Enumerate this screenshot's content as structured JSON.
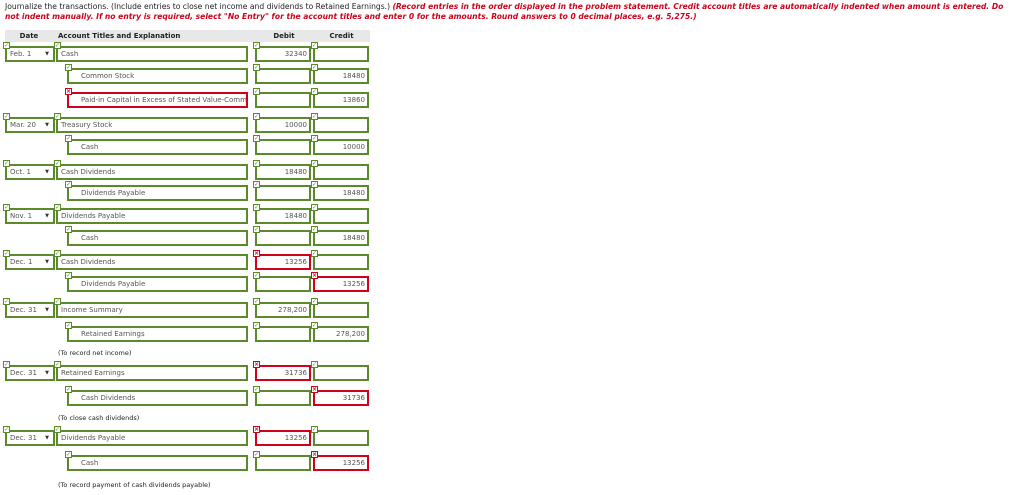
{
  "instructions": {
    "main": "Journalize the transactions. (Include entries to close net income and dividends to Retained Earnings.) ",
    "red": "(Record entries in the order displayed in the problem statement. Credit account titles are automatically indented when amount is entered. Do not indent manually. If no entry is required, select \"No Entry\" for the account titles and enter 0 for the amounts. Round answers to 0 decimal places, e.g. 5,275.)"
  },
  "table": {
    "headers": {
      "date": "Date",
      "account": "Account Titles and Explanation",
      "debit": "Debit",
      "credit": "Credit"
    },
    "rows": [
      {
        "date": "Feb. 1",
        "account": "Cash",
        "debit": "32340",
        "credit": "",
        "indent": false
      },
      {
        "date": "",
        "account": "Common Stock",
        "debit": "",
        "credit": "18480",
        "indent": true
      },
      {
        "date": "",
        "account": "Paid-in Capital in Excess of Stated Value-Common",
        "debit": "",
        "credit": "13860",
        "indent": true
      },
      {
        "date": "Mar. 20",
        "account": "Treasury Stock",
        "debit": "10000",
        "credit": "",
        "indent": false
      },
      {
        "date": "",
        "account": "Cash",
        "debit": "",
        "credit": "10000",
        "indent": true
      },
      {
        "date": "Oct. 1",
        "account": "Cash Dividends",
        "debit": "18480",
        "credit": "",
        "indent": false
      },
      {
        "date": "",
        "account": "Dividends Payable",
        "debit": "",
        "credit": "18480",
        "indent": true
      },
      {
        "date": "Nov. 1",
        "account": "Dividends Payable",
        "debit": "18480",
        "credit": "",
        "indent": false
      },
      {
        "date": "",
        "account": "Cash",
        "debit": "",
        "credit": "18480",
        "indent": true
      },
      {
        "date": "Dec. 1",
        "account": "Cash Dividends",
        "debit": "13256",
        "credit": "",
        "indent": false
      },
      {
        "date": "",
        "account": "Dividends Payable",
        "debit": "",
        "credit": "13256",
        "indent": true
      },
      {
        "date": "Dec. 31",
        "account": "Income Summary",
        "debit": "278,200",
        "credit": "",
        "indent": false
      },
      {
        "date": "",
        "account": "Retained Earnings",
        "debit": "",
        "credit": "278,200",
        "indent": true
      },
      {
        "date": "Dec. 31",
        "account": "Retained Earnings",
        "debit": "31736",
        "credit": "",
        "indent": false
      },
      {
        "date": "",
        "account": "Cash Dividends",
        "debit": "",
        "credit": "31736",
        "indent": true
      },
      {
        "date": "Dec. 31",
        "account": "Dividends Payable",
        "debit": "13256",
        "credit": "",
        "indent": false
      },
      {
        "date": "",
        "account": "Cash",
        "debit": "",
        "credit": "13256",
        "indent": true
      }
    ],
    "notes": [
      "(To record net income)",
      "(To close cash dividends)",
      "(To record payment of cash dividends payable)"
    ]
  },
  "colors": {
    "correct_border": "#5a8a2a",
    "incorrect_border": "#d0021b"
  },
  "icons": {
    "correct": "check-icon",
    "incorrect": "x-icon",
    "dropdown": "dropdown-arrow-icon"
  }
}
